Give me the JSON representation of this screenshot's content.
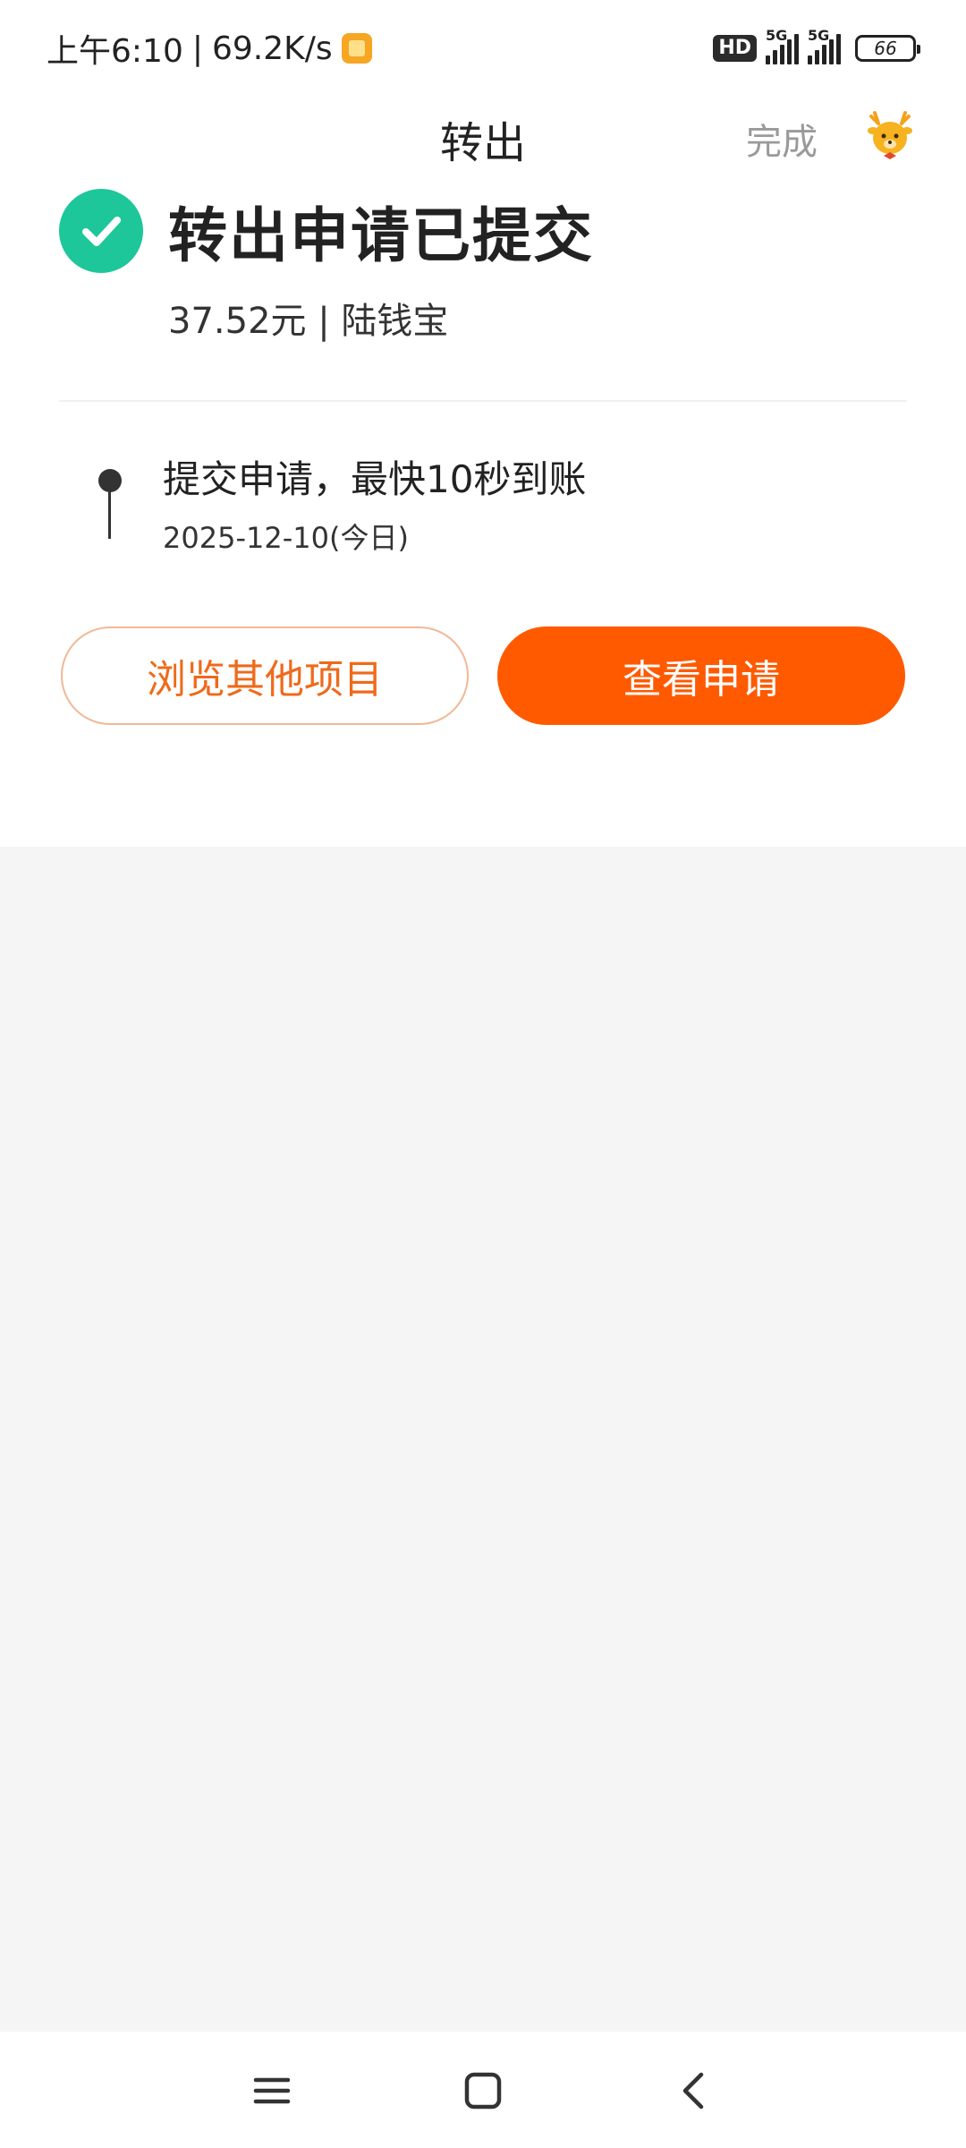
{
  "status_bar": {
    "time": "上午6:10",
    "separator": "|",
    "speed": "69.2K/s",
    "hd_label": "HD",
    "signal1_label": "5G",
    "signal2_label": "5G",
    "battery_level": "66"
  },
  "header": {
    "title": "转出",
    "done_label": "完成",
    "mascot_icon": "deer-mascot-icon"
  },
  "result": {
    "title": "转出申请已提交",
    "subtitle": "37.52元 | 陆钱宝",
    "icon": "check-circle-icon",
    "icon_color": "#1dc79a"
  },
  "timeline": {
    "step_title": "提交申请，最快10秒到账",
    "step_date": "2025-12-10(今日)"
  },
  "buttons": {
    "browse_label": "浏览其他项目",
    "view_label": "查看申请",
    "accent_color": "#ff5a00"
  },
  "system_nav": {
    "menu_icon": "menu-icon",
    "home_icon": "home-icon",
    "back_icon": "back-icon"
  }
}
